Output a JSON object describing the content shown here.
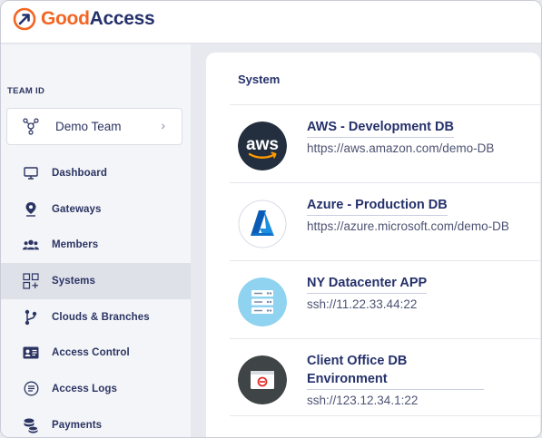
{
  "brand": {
    "name_part1": "Good",
    "name_part2": "Access",
    "accent": "#f26522",
    "navy": "#25316b"
  },
  "sidebar": {
    "team_label": "TEAM ID",
    "team_name": "Demo Team",
    "team_chevron": "›",
    "items": [
      {
        "label": "Dashboard",
        "icon": "monitor-icon"
      },
      {
        "label": "Gateways",
        "icon": "location-pin-icon"
      },
      {
        "label": "Members",
        "icon": "users-icon"
      },
      {
        "label": "Systems",
        "icon": "systems-grid-icon",
        "active": true
      },
      {
        "label": "Clouds & Branches",
        "icon": "branch-icon"
      },
      {
        "label": "Access Control",
        "icon": "id-card-icon"
      },
      {
        "label": "Access Logs",
        "icon": "list-circle-icon"
      },
      {
        "label": "Payments",
        "icon": "coins-icon"
      }
    ]
  },
  "main": {
    "section_title": "System",
    "systems": [
      {
        "name": "AWS - Development DB",
        "address": "https://aws.amazon.com/demo-DB",
        "icon": "aws-logo-icon"
      },
      {
        "name": "Azure - Production DB",
        "address": "https://azure.microsoft.com/demo-DB",
        "icon": "azure-logo-icon"
      },
      {
        "name": "NY Datacenter APP",
        "address": "ssh://11.22.33.44:22",
        "icon": "server-rack-icon"
      },
      {
        "name": "Client Office DB Environment",
        "address": "ssh://123.12.34.1:22",
        "icon": "office-window-icon"
      }
    ]
  }
}
